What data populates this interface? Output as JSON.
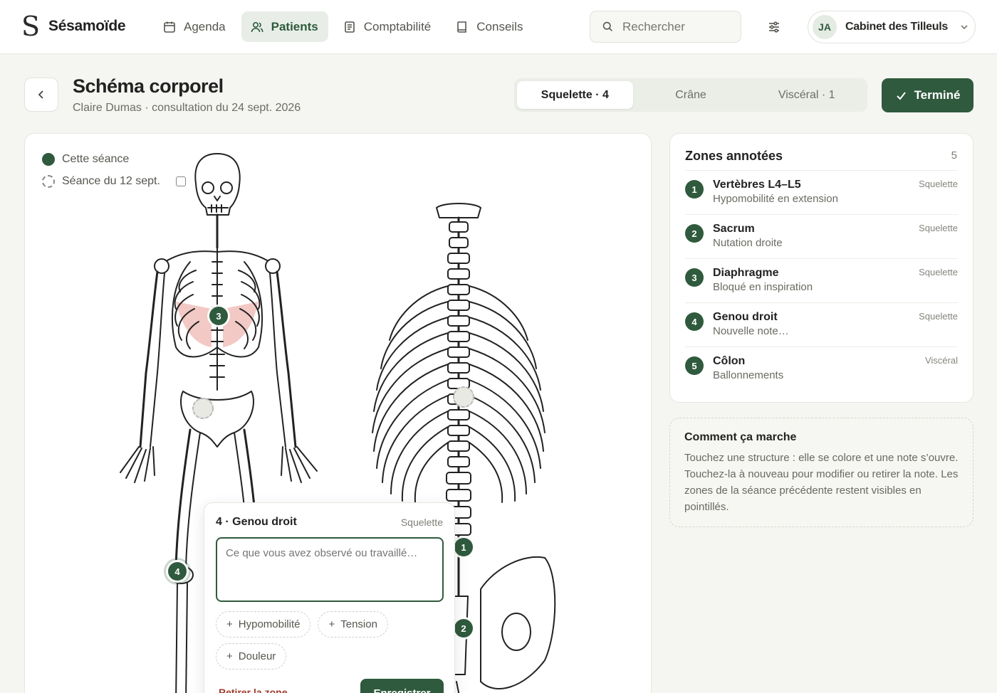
{
  "app": {
    "name": "Sésamoïde",
    "logo_glyph": "S"
  },
  "nav": [
    {
      "label": "Agenda",
      "icon": "calendar-icon",
      "active": false
    },
    {
      "label": "Patients",
      "icon": "users-icon",
      "active": true
    },
    {
      "label": "Comptabilité",
      "icon": "receipt-icon",
      "active": false
    },
    {
      "label": "Conseils",
      "icon": "book-icon",
      "active": false
    }
  ],
  "search": {
    "placeholder": "Rechercher"
  },
  "account": {
    "initials": "JA",
    "name": "Cabinet des Tilleuls"
  },
  "header": {
    "title": "Schéma corporel",
    "subtitle": "Claire Dumas · consultation du 24 sept. 2026",
    "done_label": "Terminé"
  },
  "view_tabs": [
    {
      "label": "Squelette · 4",
      "active": true
    },
    {
      "label": "Crâne",
      "active": false
    },
    {
      "label": "Viscéral · 1",
      "active": false
    }
  ],
  "legend": {
    "current": "Cette séance",
    "previous": "Séance du 12 sept."
  },
  "markers": [
    {
      "num": "1",
      "zone": "Vertèbres L4–L5"
    },
    {
      "num": "2",
      "zone": "Sacrum"
    },
    {
      "num": "3",
      "zone": "Diaphragme"
    },
    {
      "num": "4",
      "zone": "Genou droit"
    }
  ],
  "note_popup": {
    "title": "4 · Genou droit",
    "category": "Squelette",
    "placeholder": "Ce que vous avez observé ou travaillé…",
    "chips": [
      "Hypomobilité",
      "Tension",
      "Douleur"
    ],
    "remove_label": "Retirer la zone",
    "save_label": "Enregistrer"
  },
  "zones_panel": {
    "title": "Zones annotées",
    "count": "5",
    "items": [
      {
        "num": "1",
        "name": "Vertèbres L4–L5",
        "desc": "Hypomobilité en extension",
        "cat": "Squelette"
      },
      {
        "num": "2",
        "name": "Sacrum",
        "desc": "Nutation droite",
        "cat": "Squelette"
      },
      {
        "num": "3",
        "name": "Diaphragme",
        "desc": "Bloqué en inspiration",
        "cat": "Squelette"
      },
      {
        "num": "4",
        "name": "Genou droit",
        "desc": "Nouvelle note…",
        "cat": "Squelette"
      },
      {
        "num": "5",
        "name": "Côlon",
        "desc": "Ballonnements",
        "cat": "Viscéral"
      }
    ]
  },
  "howto": {
    "title": "Comment ça marche",
    "body": "Touchez une structure : elle se colore et une note s’ouvre. Touchez-la à nouveau pour modifier ou retirer la note. Les zones de la séance précédente restent visibles en pointillés."
  },
  "colors": {
    "accent": "#2f5a3d",
    "highlight": "#f2c9c4",
    "background": "#f5f5f1"
  }
}
